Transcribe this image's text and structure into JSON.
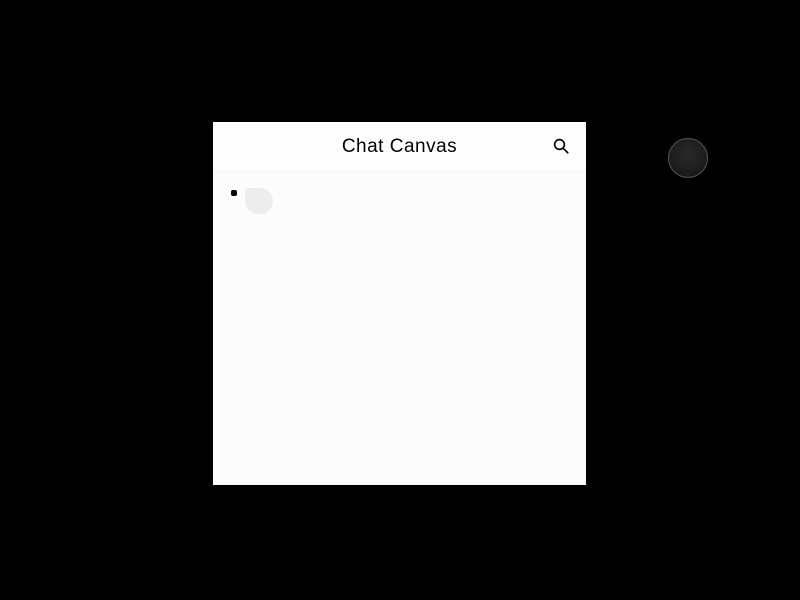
{
  "header": {
    "title": "Chat  Canvas"
  },
  "icons": {
    "search": "search-icon"
  }
}
